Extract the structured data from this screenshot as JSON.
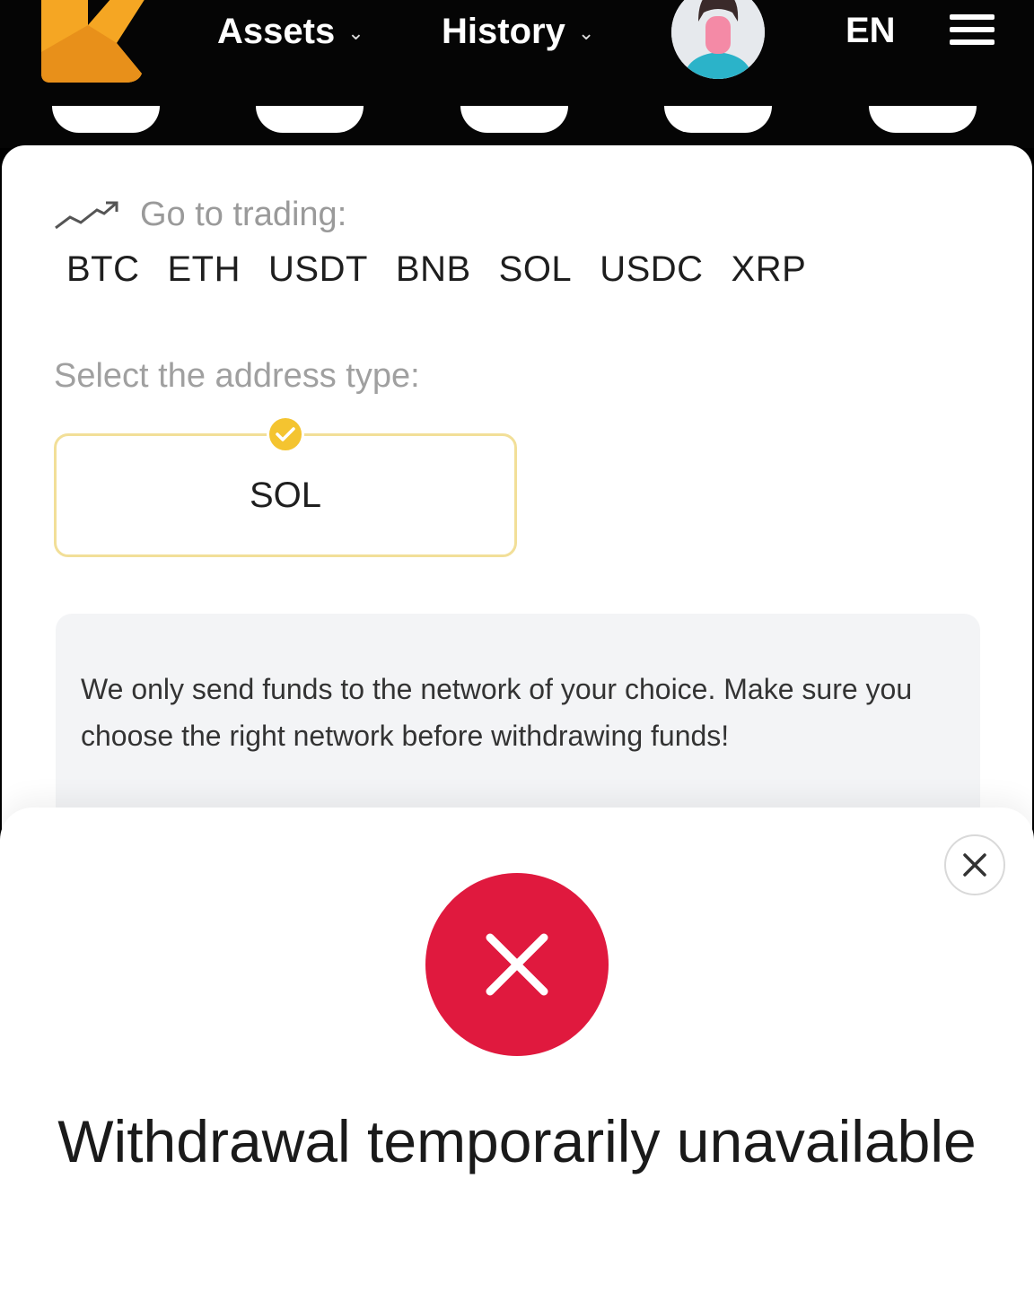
{
  "nav": {
    "assets_label": "Assets",
    "history_label": "History",
    "language": "EN",
    "brand_color": "#f5a623"
  },
  "trading": {
    "label": "Go to trading:",
    "coins": [
      "BTC",
      "ETH",
      "USDT",
      "BNB",
      "SOL",
      "USDC",
      "XRP"
    ]
  },
  "address": {
    "label": "Select the address type:",
    "selected_option": "SOL",
    "accent_color": "#f4c430"
  },
  "notice": {
    "text": "We only send funds to the network of your choice. Make sure you choose the right network before withdrawing funds!"
  },
  "modal": {
    "title": "Withdrawal temporarily unavailable",
    "error_color": "#e0193e"
  }
}
